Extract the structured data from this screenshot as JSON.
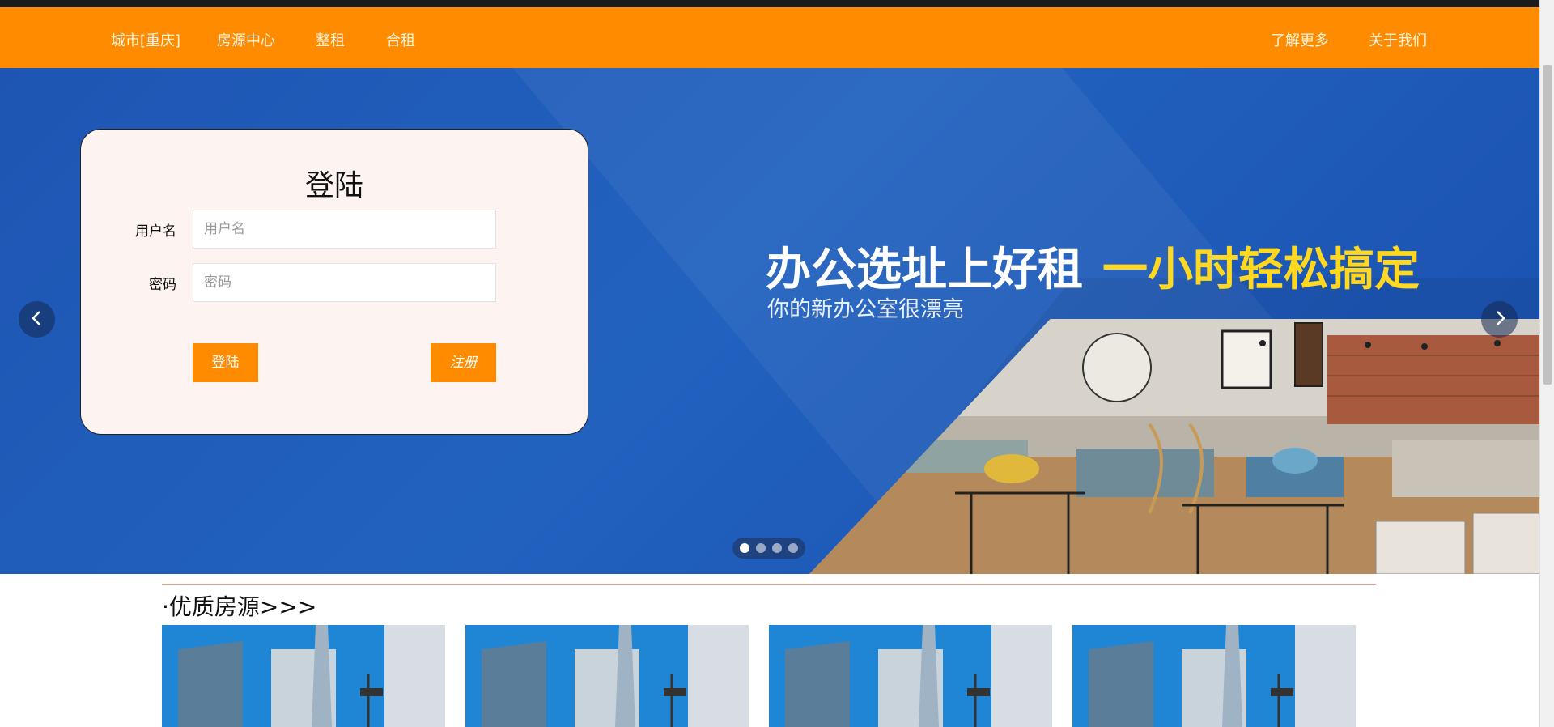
{
  "nav": {
    "city": "城市[重庆]",
    "listing_center": "房源中心",
    "whole_rent": "整租",
    "shared_rent": "合租",
    "learn_more": "了解更多",
    "about_us": "关于我们"
  },
  "login": {
    "title": "登陆",
    "username_label": "用户名",
    "username_placeholder": "用户名",
    "password_label": "密码",
    "password_placeholder": "密码",
    "login_button": "登陆",
    "register_button": "注册"
  },
  "banner": {
    "headline": "办公选址上好租",
    "headline_accent": "一小时轻松搞定",
    "subline": "你的新办公室很漂亮",
    "slide_count": 4,
    "active_slide": 1
  },
  "section": {
    "title": "·优质房源>>>"
  },
  "colors": {
    "nav_bg": "#ff8c00",
    "button_bg": "#ff8c00",
    "accent_yellow": "#ffd81f",
    "hero_blue": "#1e55b3"
  }
}
